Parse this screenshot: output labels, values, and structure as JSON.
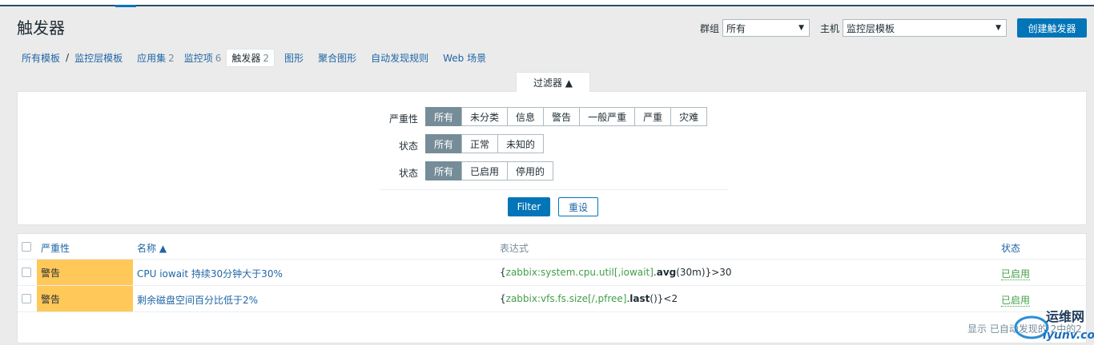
{
  "page": {
    "title": "触发器"
  },
  "header": {
    "group_label": "群组",
    "group_value": "所有",
    "host_label": "主机",
    "host_value": "监控层模板",
    "create_button": "创建触发器"
  },
  "nav": {
    "all_templates": "所有模板",
    "sep": "/",
    "template": "监控层模板",
    "apps": "应用集",
    "apps_count": "2",
    "items": "监控项",
    "items_count": "6",
    "triggers": "触发器",
    "triggers_count": "2",
    "graphs": "图形",
    "screens": "聚合图形",
    "discovery": "自动发现规则",
    "web": "Web 场景"
  },
  "filter": {
    "tab_label": "过滤器 ▲",
    "severity_label": "严重性",
    "severity_options": [
      "所有",
      "未分类",
      "信息",
      "警告",
      "一般严重",
      "严重",
      "灾难"
    ],
    "state_label": "状态",
    "state_options": [
      "所有",
      "正常",
      "未知的"
    ],
    "status_label": "状态",
    "status_options": [
      "所有",
      "已启用",
      "停用的"
    ],
    "filter_button": "Filter",
    "reset_button": "重设"
  },
  "table": {
    "headers": {
      "severity": "严重性",
      "name": "名称 ▲",
      "expression": "表达式",
      "status": "状态"
    },
    "rows": [
      {
        "severity": "警告",
        "name": "CPU iowait 持续30分钟大于30%",
        "expr_open": "{",
        "expr_key": "zabbix:system.cpu.util[,iowait]",
        "expr_dot": ".",
        "expr_func": "avg",
        "expr_args": "(30m)",
        "expr_rest": "}>30",
        "status": "已启用"
      },
      {
        "severity": "警告",
        "name": "剩余磁盘空间百分比低于2%",
        "expr_open": "{",
        "expr_key": "zabbix:vfs.fs.size[/,pfree]",
        "expr_dot": ".",
        "expr_func": "last",
        "expr_args": "()",
        "expr_rest": "}<2",
        "status": "已启用"
      }
    ],
    "footer": "显示 已自动发现的 2中的2"
  },
  "watermark": {
    "line1": "运维网",
    "line2": "iyunv.com"
  },
  "colors": {
    "accent": "#0275b8",
    "warning": "#ffc859",
    "enabled": "#429e47",
    "seg_active": "#768d99"
  }
}
